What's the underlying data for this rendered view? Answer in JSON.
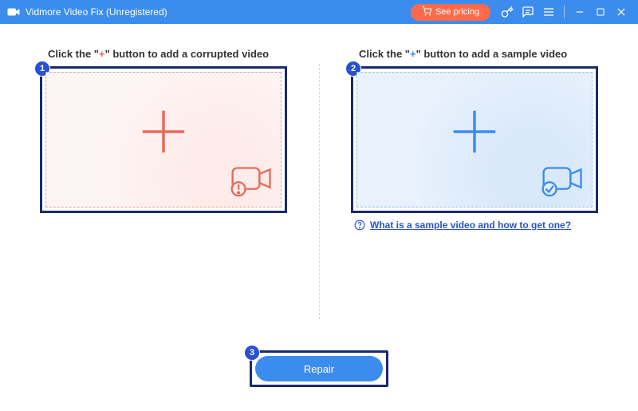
{
  "titlebar": {
    "title": "Vidmore Video Fix (Unregistered)",
    "pricing_label": "See pricing"
  },
  "left": {
    "heading_pre": "Click the \"",
    "heading_post": "\" button to add a corrupted video",
    "step": "1"
  },
  "right": {
    "heading_pre": "Click the \"",
    "heading_post": "\" button to add a sample video",
    "step": "2",
    "help_text": "What is a sample video and how to get one?"
  },
  "footer": {
    "step": "3",
    "repair_label": "Repair"
  },
  "colors": {
    "accent_blue": "#3c8cee",
    "accent_red": "#e66b5c",
    "step_badge": "#2950d1",
    "highlight_border": "#1a2a6c",
    "pricing_bg": "#ff6b4a"
  }
}
